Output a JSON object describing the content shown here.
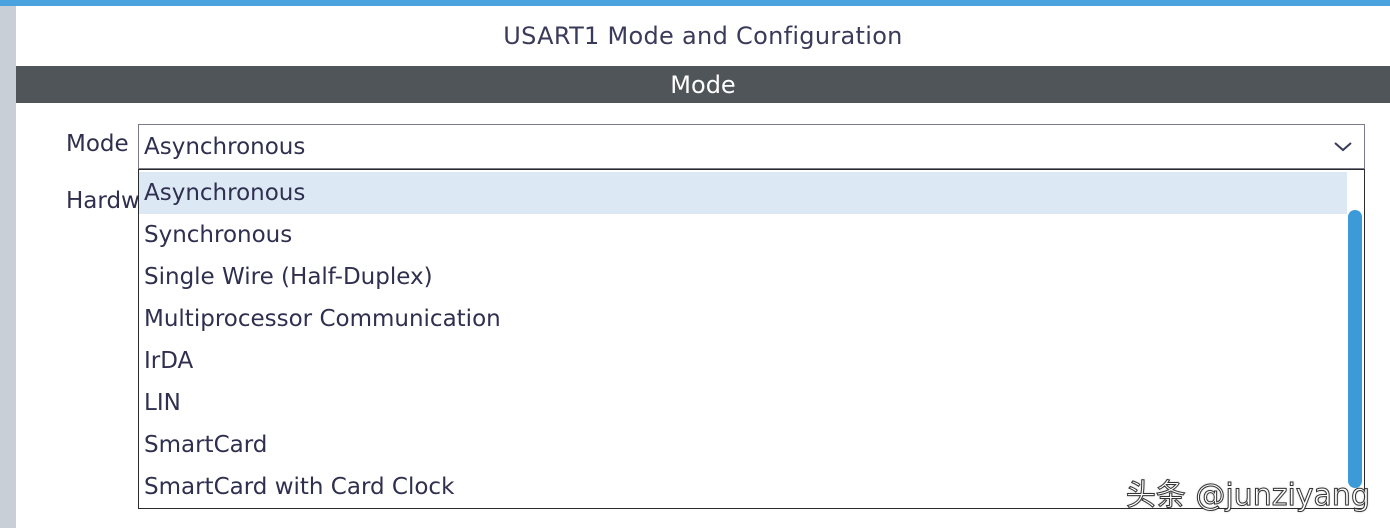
{
  "panel": {
    "title": "USART1 Mode and Configuration",
    "section_header": "Mode"
  },
  "fields": {
    "mode_label": "Mode",
    "hardware_label_partial": "Hardw"
  },
  "mode_select": {
    "selected_value": "Asynchronous",
    "options": [
      "Asynchronous",
      "Synchronous",
      "Single Wire (Half-Duplex)",
      "Multiprocessor Communication",
      "IrDA",
      "LIN",
      "SmartCard",
      "SmartCard with Card Clock"
    ],
    "highlighted_index": 0
  },
  "watermark": "头条 @junziyang",
  "icons": {
    "dropdown": "chevron-down-icon"
  },
  "colors": {
    "accent_blue": "#3d9ad8",
    "section_header_bg": "#505559",
    "highlight_bg": "#dde8f5",
    "text": "#2f2f4f"
  }
}
